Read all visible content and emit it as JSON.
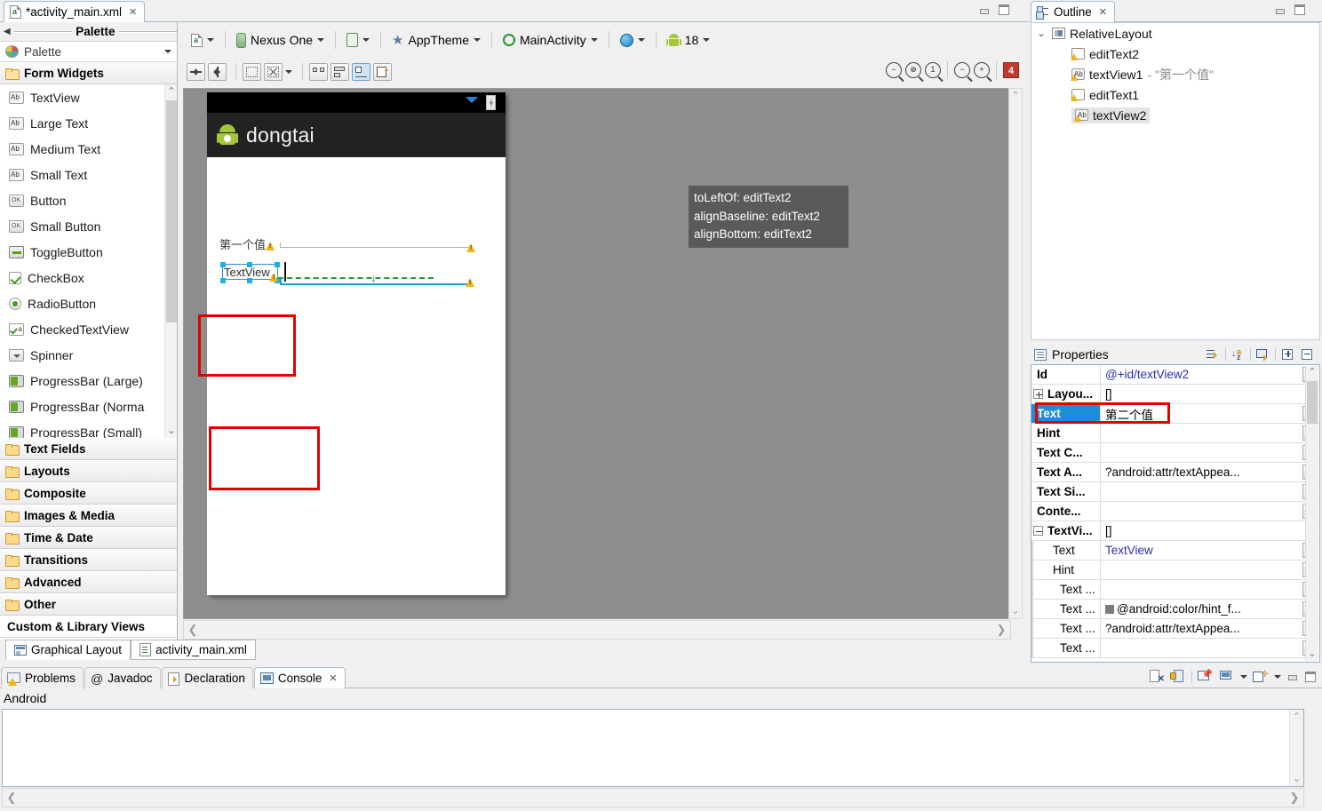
{
  "editor": {
    "tab": {
      "label": "*activity_main.xml",
      "icon": "xml-file-icon",
      "close": "✕"
    },
    "bottom_tabs": [
      {
        "label": "Graphical Layout",
        "icon": "graphical-layout-icon",
        "selected": true
      },
      {
        "label": "activity_main.xml",
        "icon": "xml-source-icon",
        "selected": false
      }
    ]
  },
  "palette": {
    "header_title": "Palette",
    "combo_label": "Palette",
    "group_form_widgets": "Form Widgets",
    "items": [
      {
        "label": "TextView",
        "icon": "ab-text-icon"
      },
      {
        "label": "Large Text",
        "icon": "ab-text-icon"
      },
      {
        "label": "Medium Text",
        "icon": "ab-text-icon"
      },
      {
        "label": "Small Text",
        "icon": "ab-text-icon"
      },
      {
        "label": "Button",
        "icon": "ok-button-icon"
      },
      {
        "label": "Small Button",
        "icon": "ok-button-icon"
      },
      {
        "label": "ToggleButton",
        "icon": "toggle-icon"
      },
      {
        "label": "CheckBox",
        "icon": "checkbox-icon"
      },
      {
        "label": "RadioButton",
        "icon": "radio-icon"
      },
      {
        "label": "CheckedTextView",
        "icon": "checked-textview-icon"
      },
      {
        "label": "Spinner",
        "icon": "spinner-icon"
      },
      {
        "label": "ProgressBar (Large)",
        "icon": "progressbar-icon"
      },
      {
        "label": "ProgressBar (Norma",
        "icon": "progressbar-icon"
      },
      {
        "label": "ProgressBar (Small)",
        "icon": "progressbar-icon"
      }
    ],
    "groups": [
      "Text Fields",
      "Layouts",
      "Composite",
      "Images & Media",
      "Time & Date",
      "Transitions",
      "Advanced",
      "Other"
    ],
    "custom_group": "Custom & Library Views"
  },
  "toolbar": {
    "config_label": "",
    "device": "Nexus One",
    "orientation": "",
    "theme": "AppTheme",
    "activity": "MainActivity",
    "locale": "",
    "api_level": "18",
    "zoom_value": "4"
  },
  "canvas": {
    "device_title": "dongtai",
    "tooltip_lines": [
      "toLeftOf: editText2",
      "alignBaseline: editText2",
      "alignBottom: editText2"
    ],
    "widget1_text": "第一个值",
    "widget2_text": "TextView"
  },
  "outline": {
    "tab_label": "Outline",
    "tab_close": "✕",
    "tree": [
      {
        "label": "RelativeLayout",
        "icon": "relativelayout-icon",
        "depth": 0,
        "twisty": "⌄",
        "selected": false,
        "suffix": ""
      },
      {
        "label": "editText2",
        "icon": "edittext-icon",
        "depth": 1,
        "twisty": "",
        "selected": false,
        "suffix": ""
      },
      {
        "label": "textView1",
        "icon": "textview-icon",
        "depth": 1,
        "twisty": "",
        "selected": false,
        "suffix": " - \"第一个值\""
      },
      {
        "label": "editText1",
        "icon": "edittext-icon",
        "depth": 1,
        "twisty": "",
        "selected": false,
        "suffix": ""
      },
      {
        "label": "textView2",
        "icon": "textview-icon",
        "depth": 1,
        "twisty": "",
        "selected": true,
        "suffix": ""
      }
    ]
  },
  "properties": {
    "title": "Properties",
    "tools": [
      "show-advanced-icon",
      "sort-alpha-icon",
      "default-properties-icon",
      "expand-all-icon",
      "collapse-all-icon"
    ],
    "rows": [
      {
        "name": "Id",
        "value": "@+id/textView2",
        "style": "blue",
        "dots": true,
        "indent": 0,
        "expander": "",
        "selected": false
      },
      {
        "name": "Layou...",
        "value": "[]",
        "style": "",
        "dots": false,
        "indent": 0,
        "expander": "plus",
        "selected": false
      },
      {
        "name": "Text",
        "value": "第二个值",
        "style": "",
        "dots": true,
        "indent": 0,
        "expander": "",
        "selected": true
      },
      {
        "name": "Hint",
        "value": "",
        "style": "",
        "dots": true,
        "indent": 0,
        "expander": "",
        "selected": false
      },
      {
        "name": "Text C...",
        "value": "",
        "style": "",
        "dots": true,
        "indent": 0,
        "expander": "",
        "selected": false
      },
      {
        "name": "Text A...",
        "value": "?android:attr/textAppea...",
        "style": "",
        "dots": true,
        "indent": 0,
        "expander": "",
        "selected": false
      },
      {
        "name": "Text Si...",
        "value": "",
        "style": "",
        "dots": true,
        "indent": 0,
        "expander": "",
        "selected": false
      },
      {
        "name": "Conte...",
        "value": "",
        "style": "",
        "dots": true,
        "indent": 0,
        "expander": "",
        "selected": false
      },
      {
        "name": "TextVi...",
        "value": "[]",
        "style": "",
        "dots": false,
        "indent": 0,
        "expander": "minus",
        "selected": false
      },
      {
        "name": "Text",
        "value": "TextView",
        "style": "blue",
        "dots": true,
        "indent": 1,
        "expander": "",
        "selected": false
      },
      {
        "name": "Hint",
        "value": "",
        "style": "",
        "dots": true,
        "indent": 1,
        "expander": "",
        "selected": false
      },
      {
        "name": "Text ...",
        "value": "",
        "style": "",
        "dots": true,
        "indent": 2,
        "expander": "",
        "selected": false
      },
      {
        "name": "Text ...",
        "value": "@android:color/hint_f...",
        "style": "swatch",
        "dots": true,
        "indent": 2,
        "expander": "",
        "selected": false
      },
      {
        "name": "Text ...",
        "value": "?android:attr/textAppea...",
        "style": "",
        "dots": true,
        "indent": 2,
        "expander": "",
        "selected": false
      },
      {
        "name": "Text ...",
        "value": "",
        "style": "",
        "dots": true,
        "indent": 2,
        "expander": "",
        "selected": false
      }
    ]
  },
  "bottom_view": {
    "tabs": [
      {
        "label": "Problems",
        "icon": "problems-icon",
        "selected": false,
        "close": ""
      },
      {
        "label": "Javadoc",
        "icon": "javadoc-icon",
        "selected": false,
        "close": ""
      },
      {
        "label": "Declaration",
        "icon": "declaration-icon",
        "selected": false,
        "close": ""
      },
      {
        "label": "Console",
        "icon": "console-icon",
        "selected": true,
        "close": "✕"
      }
    ],
    "console_label": "Android",
    "console_text": ""
  },
  "colors": {
    "accent": "#1a8fd8",
    "red_highlight": "#e00000",
    "android_green": "#a4c639",
    "zoom_badge": "#c0392b"
  }
}
